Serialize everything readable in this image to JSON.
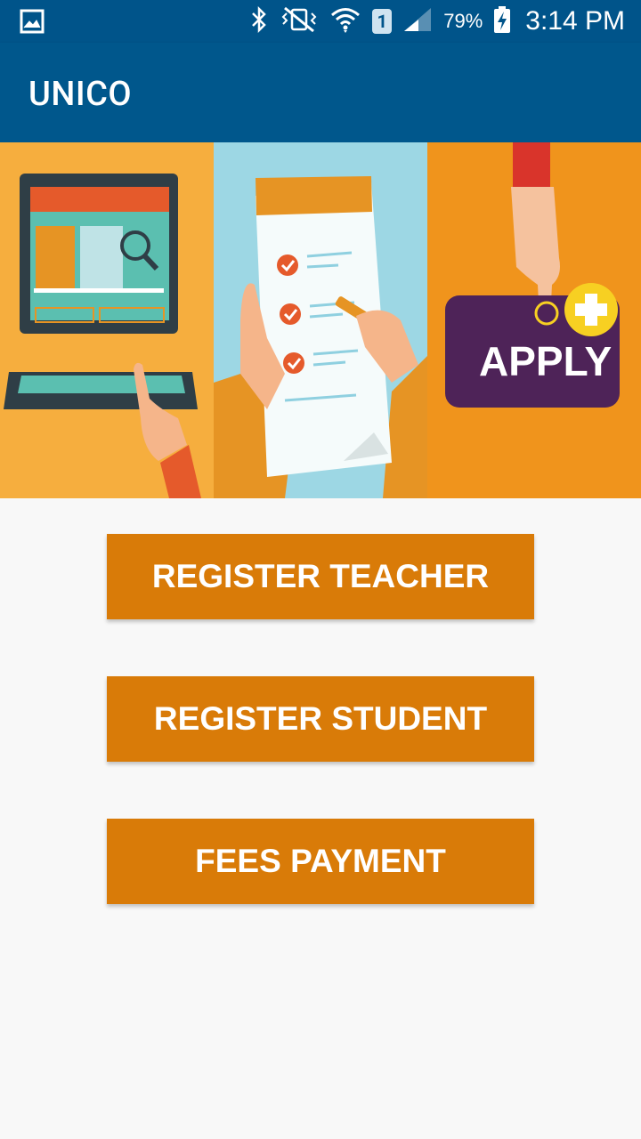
{
  "status_bar": {
    "battery_percent": "79%",
    "time": "3:14 PM",
    "sim_slot": "1",
    "icons": [
      "gallery-notification-icon",
      "bluetooth-icon",
      "vibrate-mute-icon",
      "wifi-icon",
      "sim-icon",
      "signal-icon",
      "battery-charging-icon"
    ]
  },
  "app_bar": {
    "title": "UNICO"
  },
  "banner": {
    "panels": [
      "laptop-illustration",
      "checklist-illustration",
      "apply-button-illustration"
    ],
    "apply_text": "APPLY",
    "colors": {
      "left_bg": "#f6ae3e",
      "middle_bg": "#9dd7e4",
      "right_bg": "#f0941c",
      "apply_bg": "#4e2358"
    }
  },
  "buttons": {
    "register_teacher": "REGISTER TEACHER",
    "register_student": "REGISTER STUDENT",
    "fees_payment": "FEES PAYMENT"
  },
  "colors": {
    "primary": "#00578c",
    "button": "#d97b08",
    "background": "#f8f8f8"
  }
}
